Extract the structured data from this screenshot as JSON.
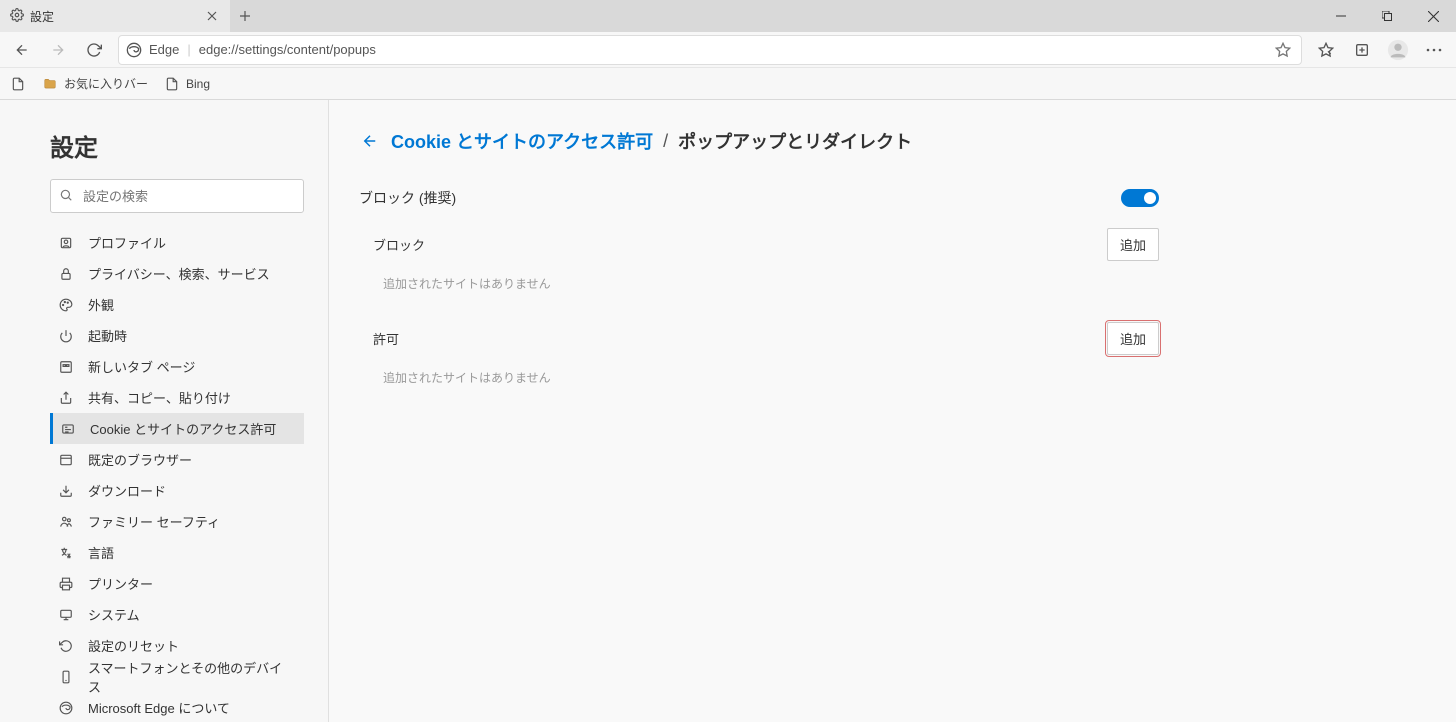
{
  "tab": {
    "title": "設定"
  },
  "address": {
    "app_label": "Edge",
    "url": "edge://settings/content/popups"
  },
  "bookmarks": {
    "favorites_bar": "お気に入りバー",
    "bing": "Bing"
  },
  "sidebar": {
    "title": "設定",
    "search_placeholder": "設定の検索",
    "items": [
      {
        "label": "プロファイル"
      },
      {
        "label": "プライバシー、検索、サービス"
      },
      {
        "label": "外観"
      },
      {
        "label": "起動時"
      },
      {
        "label": "新しいタブ ページ"
      },
      {
        "label": "共有、コピー、貼り付け"
      },
      {
        "label": "Cookie とサイトのアクセス許可"
      },
      {
        "label": "既定のブラウザー"
      },
      {
        "label": "ダウンロード"
      },
      {
        "label": "ファミリー セーフティ"
      },
      {
        "label": "言語"
      },
      {
        "label": "プリンター"
      },
      {
        "label": "システム"
      },
      {
        "label": "設定のリセット"
      },
      {
        "label": "スマートフォンとその他のデバイス"
      },
      {
        "label": "Microsoft Edge について"
      }
    ]
  },
  "main": {
    "breadcrumb_link": "Cookie とサイトのアクセス許可",
    "breadcrumb_sep": "/",
    "breadcrumb_current": "ポップアップとリダイレクト",
    "block_recommended": "ブロック (推奨)",
    "block_label": "ブロック",
    "allow_label": "許可",
    "add_button": "追加",
    "empty_msg": "追加されたサイトはありません"
  }
}
